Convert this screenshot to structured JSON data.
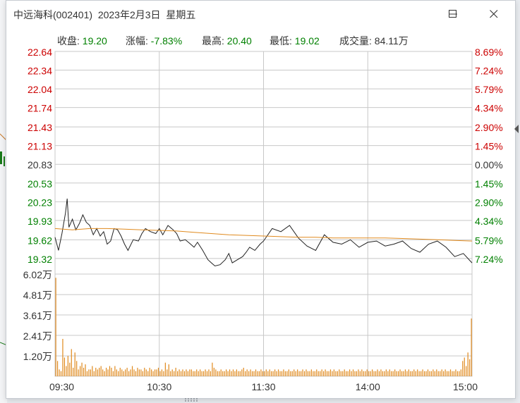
{
  "window": {
    "title": "中远海科(002401)  2023年2月3日  星期五",
    "minimize_icon": "minimize-icon",
    "maximize_icon": "maximize-icon",
    "close_icon": "close-icon"
  },
  "stats": [
    {
      "label": "收盘:",
      "value": "19.20"
    },
    {
      "label": "涨幅:",
      "value": "-7.83%"
    },
    {
      "label": "最高:",
      "value": "20.40"
    },
    {
      "label": "最低:",
      "value": "19.02"
    },
    {
      "label": "成交量:",
      "value": "84.11万"
    }
  ],
  "colors": {
    "up": "#cc0000",
    "down": "#008000",
    "neutral": "#333333",
    "price_line": "#222222",
    "avg_line": "#e08a1e",
    "volume_bar": "#e08a1e",
    "grid": "#c8c8c8"
  },
  "chart_data": {
    "type": "line",
    "title": "",
    "xlabel": "",
    "ylabel": "",
    "x_ticks": [
      "09:30",
      "10:30",
      "11:30",
      "14:00",
      "15:00"
    ],
    "price_ticks": [
      "22.64",
      "22.34",
      "22.04",
      "21.74",
      "21.43",
      "21.13",
      "20.83",
      "20.53",
      "20.23",
      "19.93",
      "19.62",
      "19.32"
    ],
    "pct_ticks": [
      "8.69%",
      "7.24%",
      "5.79%",
      "4.34%",
      "2.90%",
      "1.45%",
      "0.00%",
      "1.45%",
      "2.90%",
      "4.34%",
      "5.79%",
      "7.24%"
    ],
    "volume_ticks": [
      "6.02万",
      "4.81万",
      "3.61万",
      "2.41万",
      "1.20万"
    ],
    "price_range": [
      19.07,
      22.64
    ],
    "volume_range": [
      0,
      6.02
    ],
    "prev_close": 20.83,
    "series": [
      {
        "role": "price",
        "x": [
          0,
          2,
          4,
          6,
          7,
          8,
          10,
          12,
          14,
          16,
          18,
          20,
          22,
          24,
          26,
          28,
          30,
          32,
          34,
          36,
          38,
          40,
          42,
          45,
          48,
          50,
          52,
          55,
          58,
          60,
          62,
          65,
          68,
          70,
          72,
          75,
          78,
          80,
          82,
          85,
          88,
          90,
          92,
          95,
          98,
          100,
          102,
          105,
          108,
          110,
          112,
          115,
          118,
          120,
          125,
          130,
          135,
          140,
          145,
          150,
          155,
          160,
          165,
          170,
          175,
          180,
          185,
          190,
          195,
          200,
          205,
          210,
          215,
          220,
          225,
          230,
          235,
          240
        ],
        "values": [
          19.66,
          19.45,
          19.72,
          20.05,
          20.28,
          19.82,
          19.95,
          19.78,
          19.88,
          20.02,
          19.9,
          19.85,
          19.7,
          19.8,
          19.68,
          19.75,
          19.55,
          19.6,
          19.8,
          19.78,
          19.68,
          19.55,
          19.45,
          19.62,
          19.6,
          19.72,
          19.8,
          19.75,
          19.72,
          19.8,
          19.7,
          19.85,
          19.78,
          19.72,
          19.6,
          19.62,
          19.55,
          19.5,
          19.58,
          19.45,
          19.3,
          19.25,
          19.2,
          19.22,
          19.3,
          19.4,
          19.25,
          19.3,
          19.35,
          19.42,
          19.5,
          19.45,
          19.55,
          19.6,
          19.8,
          19.75,
          19.85,
          19.65,
          19.52,
          19.45,
          19.7,
          19.58,
          19.55,
          19.62,
          19.5,
          19.58,
          19.6,
          19.52,
          19.55,
          19.6,
          19.48,
          19.42,
          19.55,
          19.6,
          19.5,
          19.35,
          19.4,
          19.25
        ],
        "name": ""
      },
      {
        "role": "average",
        "x": [
          0,
          10,
          20,
          30,
          40,
          50,
          60,
          70,
          80,
          90,
          100,
          110,
          120,
          130,
          140,
          150,
          160,
          170,
          180,
          190,
          200,
          210,
          220,
          230,
          240
        ],
        "values": [
          19.8,
          19.78,
          19.8,
          19.8,
          19.79,
          19.78,
          19.77,
          19.76,
          19.74,
          19.72,
          19.7,
          19.69,
          19.68,
          19.67,
          19.66,
          19.66,
          19.65,
          19.65,
          19.65,
          19.65,
          19.64,
          19.63,
          19.62,
          19.61,
          19.6
        ],
        "name": ""
      }
    ],
    "volume": [
      5.8,
      0.9,
      0.4,
      0.3,
      2.2,
      1.1,
      0.6,
      1.2,
      0.8,
      1.6,
      0.5,
      1.4,
      0.9,
      0.4,
      0.6,
      0.8,
      0.5,
      0.7,
      0.3,
      0.4,
      0.4,
      0.6,
      0.3,
      0.5,
      0.4,
      0.5,
      0.6,
      0.4,
      0.3,
      0.5,
      0.4,
      0.6,
      0.5,
      0.3,
      0.6,
      0.4,
      0.3,
      0.5,
      0.4,
      0.3,
      0.4,
      0.5,
      0.3,
      0.4,
      0.6,
      0.4,
      0.3,
      0.5,
      0.4,
      0.4,
      0.3,
      0.5,
      0.4,
      0.3,
      0.5,
      0.4,
      0.3,
      0.4,
      0.4,
      0.5,
      0.3,
      0.4,
      0.3,
      0.8,
      0.4,
      0.7,
      0.3,
      0.4,
      0.3,
      0.5,
      0.3,
      0.4,
      0.3,
      0.4,
      0.3,
      0.4,
      0.3,
      0.4,
      0.4,
      0.3,
      0.3,
      0.4,
      0.3,
      0.4,
      0.3,
      0.3,
      0.4,
      0.3,
      0.4,
      0.3,
      0.8,
      0.5,
      0.4,
      0.3,
      0.3,
      0.4,
      0.3,
      0.3,
      0.4,
      0.3,
      0.4,
      0.3,
      0.4,
      0.3,
      0.4,
      0.3,
      0.3,
      0.4,
      0.5,
      0.3,
      0.4,
      0.3,
      0.4,
      0.3,
      0.3,
      0.4,
      0.3,
      0.3,
      0.4,
      0.3,
      0.3,
      0.4,
      0.3,
      0.4,
      0.3,
      0.3,
      0.4,
      0.3,
      0.4,
      0.3,
      0.3,
      0.4,
      0.3,
      0.3,
      0.4,
      0.3,
      0.3,
      0.4,
      0.3,
      0.4,
      0.3,
      0.3,
      0.4,
      0.3,
      0.4,
      0.3,
      0.3,
      0.4,
      0.3,
      0.3,
      0.4,
      0.3,
      0.3,
      0.4,
      0.3,
      0.4,
      0.3,
      0.3,
      0.4,
      0.3,
      0.4,
      0.3,
      0.3,
      0.4,
      0.3,
      0.3,
      0.4,
      0.3,
      0.3,
      0.4,
      0.3,
      0.4,
      0.3,
      0.3,
      0.4,
      0.3,
      0.4,
      0.3,
      0.3,
      0.4,
      0.3,
      0.3,
      0.4,
      0.3,
      0.3,
      0.4,
      0.3,
      0.4,
      0.3,
      0.3,
      0.4,
      0.3,
      0.4,
      0.3,
      0.3,
      0.4,
      0.3,
      0.3,
      0.4,
      0.3,
      0.3,
      0.4,
      0.3,
      0.4,
      0.3,
      0.3,
      0.4,
      0.3,
      0.4,
      0.3,
      0.3,
      0.4,
      0.3,
      0.3,
      0.4,
      0.3,
      0.3,
      0.4,
      0.3,
      0.4,
      0.3,
      0.3,
      0.4,
      0.3,
      0.4,
      0.3,
      0.3,
      0.4,
      0.3,
      0.3,
      0.4,
      0.3,
      0.3,
      0.4,
      0.9,
      1.1,
      0.6,
      1.4,
      1.0,
      3.4
    ],
    "grid": true
  }
}
